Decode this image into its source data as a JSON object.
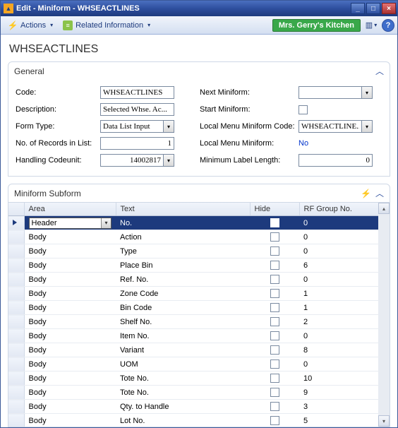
{
  "window": {
    "title": "Edit - Miniform - WHSEACTLINES"
  },
  "ribbon": {
    "actions_label": "Actions",
    "related_label": "Related Information",
    "company": "Mrs. Gerry's Kitchen"
  },
  "page": {
    "title": "WHSEACTLINES"
  },
  "general": {
    "header": "General",
    "code_label": "Code:",
    "code_value": "WHSEACTLINES",
    "description_label": "Description:",
    "description_value": "Selected Whse. Ac...",
    "form_type_label": "Form Type:",
    "form_type_value": "Data List Input",
    "records_label": "No. of Records in List:",
    "records_value": "1",
    "codeunit_label": "Handling Codeunit:",
    "codeunit_value": "14002817",
    "next_label": "Next Miniform:",
    "next_value": "",
    "start_label": "Start Miniform:",
    "local_code_label": "Local Menu Miniform Code:",
    "local_code_value": "WHSEACTLINE...",
    "local_menu_label": "Local Menu Miniform:",
    "local_menu_value": "No",
    "min_label_label": "Minimum Label Length:",
    "min_label_value": "0"
  },
  "subform": {
    "header": "Miniform Subform",
    "columns": {
      "area": "Area",
      "text": "Text",
      "hide": "Hide",
      "rf": "RF Group No."
    },
    "rows": [
      {
        "area": "Header",
        "text": "No.",
        "rf": "0",
        "sel": true
      },
      {
        "area": "Body",
        "text": "Action",
        "rf": "0"
      },
      {
        "area": "Body",
        "text": "Type",
        "rf": "0"
      },
      {
        "area": "Body",
        "text": "Place Bin",
        "rf": "6"
      },
      {
        "area": "Body",
        "text": "Ref. No.",
        "rf": "0"
      },
      {
        "area": "Body",
        "text": "Zone Code",
        "rf": "1"
      },
      {
        "area": "Body",
        "text": "Bin Code",
        "rf": "1"
      },
      {
        "area": "Body",
        "text": "Shelf No.",
        "rf": "2"
      },
      {
        "area": "Body",
        "text": "Item No.",
        "rf": "0"
      },
      {
        "area": "Body",
        "text": "Variant",
        "rf": "8"
      },
      {
        "area": "Body",
        "text": "UOM",
        "rf": "0"
      },
      {
        "area": "Body",
        "text": "Tote No.",
        "rf": "10"
      },
      {
        "area": "Body",
        "text": "Tote No.",
        "rf": "9"
      },
      {
        "area": "Body",
        "text": "Qty. to Handle",
        "rf": "3"
      },
      {
        "area": "Body",
        "text": "Lot No.",
        "rf": "5"
      }
    ]
  }
}
